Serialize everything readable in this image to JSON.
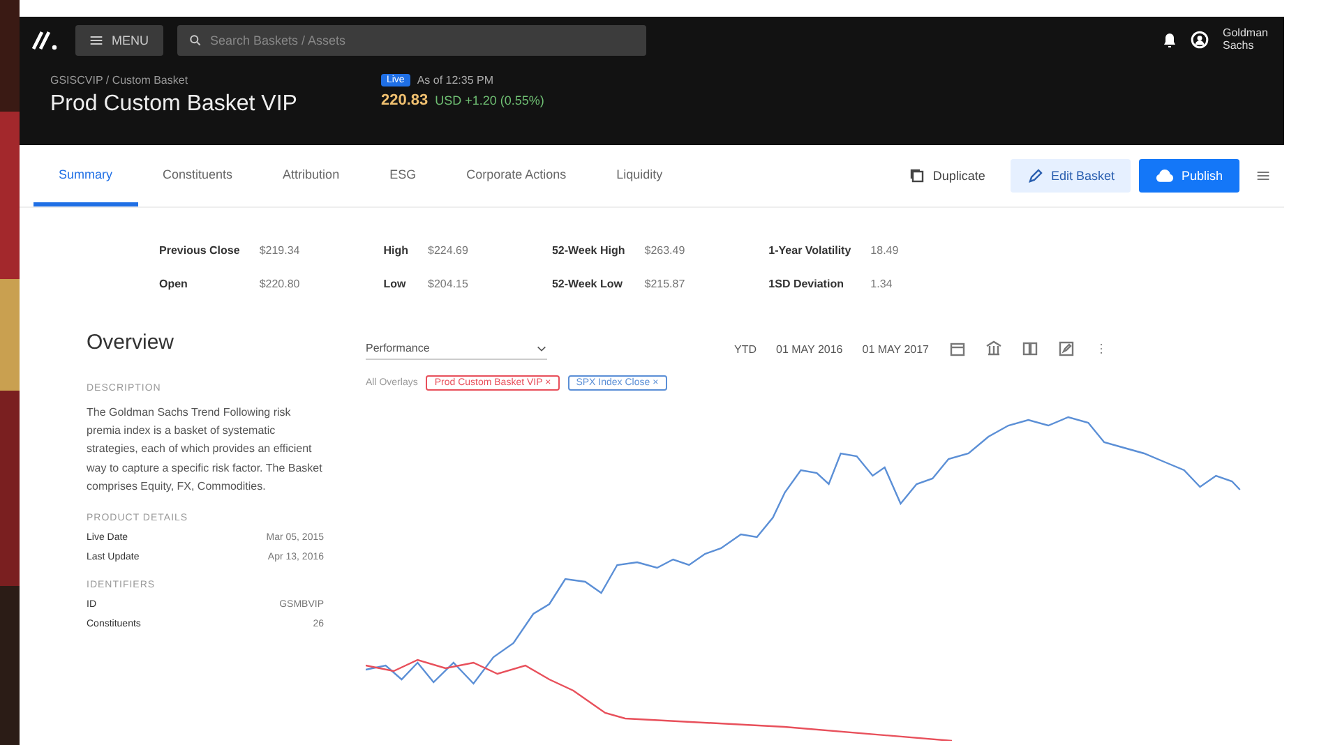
{
  "header": {
    "menu_label": "MENU",
    "search": {
      "placeholder": "Search Baskets / Assets"
    },
    "user": "Goldman Sachs"
  },
  "basket": {
    "breadcrumb": "GSISCVIP / Custom Basket",
    "title": "Prod Custom Basket VIP",
    "status": "Live",
    "as_of": "As of 12:35 PM",
    "price": "220.83",
    "change": "USD +1.20 (0.55%)"
  },
  "tabs": [
    {
      "label": "Summary",
      "selected": true
    },
    {
      "label": "Constituents",
      "selected": false
    },
    {
      "label": "Attribution",
      "selected": false
    },
    {
      "label": "ESG",
      "selected": false
    },
    {
      "label": "Corporate Actions",
      "selected": false
    },
    {
      "label": "Liquidity",
      "selected": false
    }
  ],
  "actions": [
    {
      "kind": "text",
      "label": "Duplicate"
    },
    {
      "kind": "soft",
      "label": "Edit Basket"
    },
    {
      "kind": "primary",
      "label": "Publish"
    }
  ],
  "stats": [
    [
      {
        "label": "Previous Close",
        "value": "$219.34"
      },
      {
        "label": "Open",
        "value": "$220.80"
      }
    ],
    [
      {
        "label": "High",
        "value": "$224.69"
      },
      {
        "label": "Low",
        "value": "$204.15"
      }
    ],
    [
      {
        "label": "52-Week High",
        "value": "$263.49"
      },
      {
        "label": "52-Week Low",
        "value": "$215.87"
      }
    ],
    [
      {
        "label": "1-Year Volatility",
        "value": "18.49"
      },
      {
        "label": "1SD Deviation",
        "value": "1.34"
      }
    ]
  ],
  "overview": {
    "title": "Overview",
    "description_heading": "DESCRIPTION",
    "description": "The Goldman Sachs Trend Following risk premia index is a basket of systematic strategies, each of which provides an efficient way to capture a specific risk factor. The Basket comprises Equity, FX, Commodities.",
    "details_heading": "PRODUCT DETAILS",
    "details": [
      {
        "label": "Live Date",
        "value": "Mar 05, 2015"
      },
      {
        "label": "Last Update",
        "value": "Apr 13, 2016"
      }
    ],
    "identifiers_heading": "IDENTIFIERS",
    "identifiers": [
      {
        "label": "ID",
        "value": "GSMBVIP"
      },
      {
        "label": "Constituents",
        "value": "26"
      }
    ]
  },
  "chart": {
    "metric": "Performance",
    "period": "YTD",
    "start_date": "01 MAY 2016",
    "end_date": "01 MAY 2017",
    "overlay_label": "All Overlays",
    "series": [
      {
        "name": "Prod Custom Basket VIP",
        "color": "#e8505b",
        "remove_glyph": "×"
      },
      {
        "name": "SPX Index Close",
        "color": "#5b8fd6",
        "remove_glyph": "×"
      }
    ]
  }
}
